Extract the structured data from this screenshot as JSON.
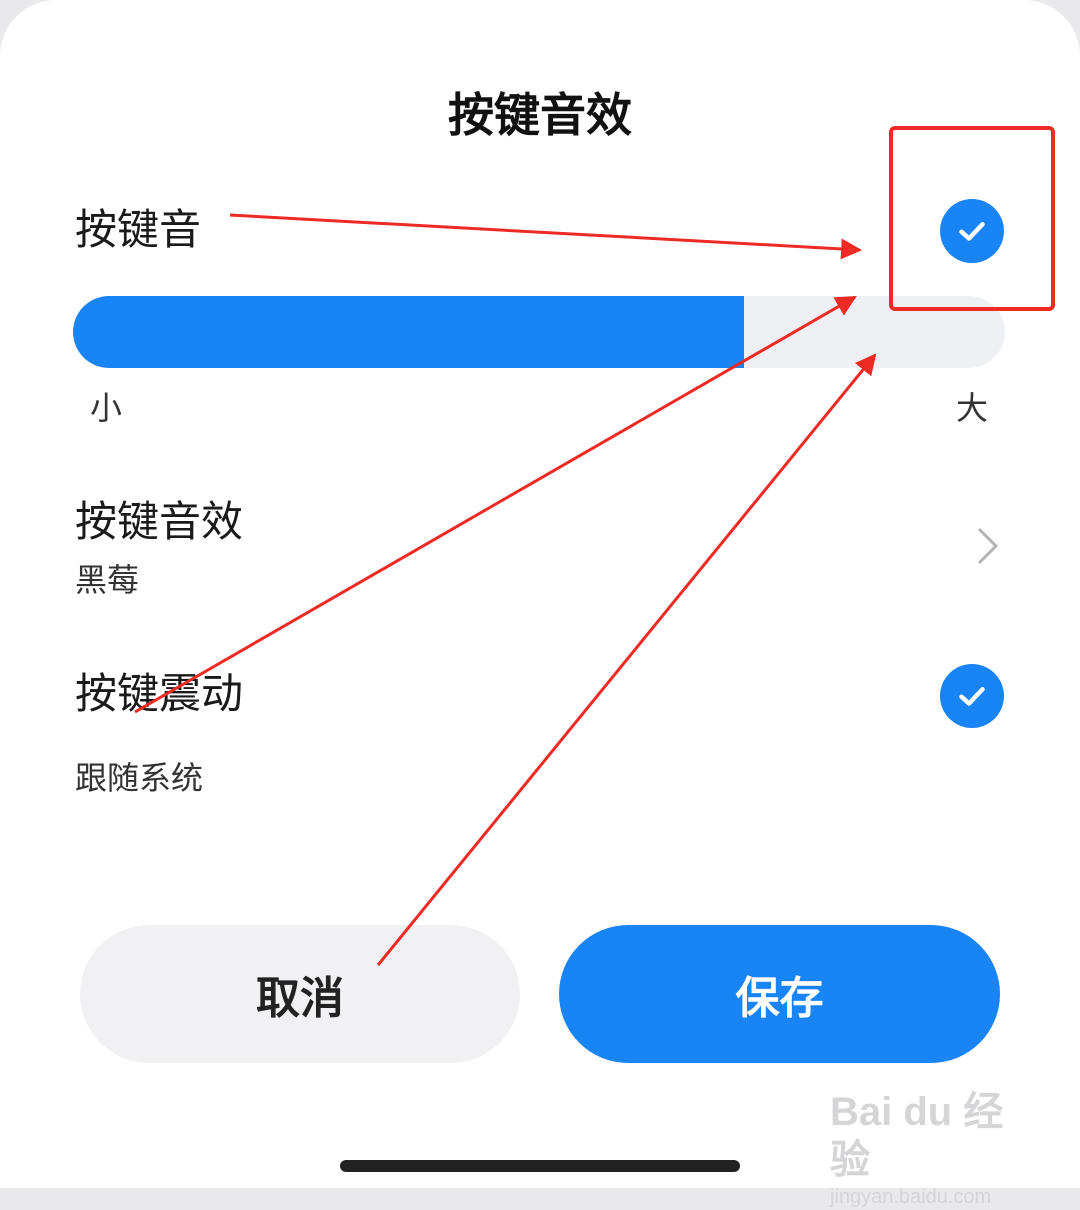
{
  "dialog": {
    "title": "按键音效"
  },
  "key_sound": {
    "label": "按键音",
    "checked": true
  },
  "volume": {
    "min_label": "小",
    "max_label": "大",
    "level": 0.72
  },
  "key_sound_effect": {
    "label": "按键音效",
    "value": "黑莓"
  },
  "key_vibration": {
    "label": "按键震动",
    "value": "跟随系统",
    "checked": true
  },
  "buttons": {
    "cancel_label": "取消",
    "save_label": "保存"
  },
  "watermark": {
    "logo": "Bai du 经验",
    "url": "jingyan.baidu.com"
  },
  "colors": {
    "accent": "#1884f5",
    "annotation": "#ee2a24",
    "track": "#eef0f4"
  },
  "icons": [
    "check-icon",
    "chevron-right-icon"
  ]
}
